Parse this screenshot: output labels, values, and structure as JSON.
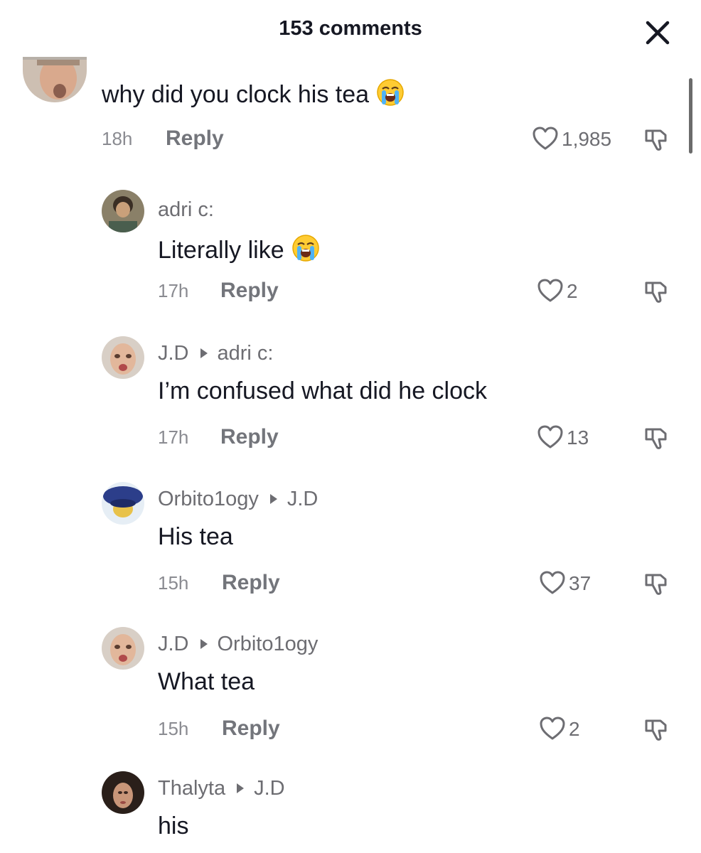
{
  "header": {
    "title": "153 comments",
    "close_icon": "close-icon"
  },
  "comments": [
    {
      "username": "",
      "reply_to": "",
      "text": "why did you clock his tea",
      "emoji": "😭",
      "time": "18h",
      "reply_label": "Reply",
      "likes": "1,985"
    },
    {
      "username": "adri c:",
      "reply_to": "",
      "text": "Literally like",
      "emoji": "😭",
      "time": "17h",
      "reply_label": "Reply",
      "likes": "2"
    },
    {
      "username": "J.D",
      "reply_to": "adri c:",
      "text": "I’m confused what did he clock",
      "emoji": "",
      "time": "17h",
      "reply_label": "Reply",
      "likes": "13"
    },
    {
      "username": "Orbito1ogy",
      "reply_to": "J.D",
      "text": "His tea",
      "emoji": "",
      "time": "15h",
      "reply_label": "Reply",
      "likes": "37"
    },
    {
      "username": "J.D",
      "reply_to": "Orbito1ogy",
      "text": "What tea",
      "emoji": "",
      "time": "15h",
      "reply_label": "Reply",
      "likes": "2"
    },
    {
      "username": "Thalyta",
      "reply_to": "J.D",
      "text": "his",
      "emoji": "",
      "time": "",
      "reply_label": "",
      "likes": ""
    }
  ],
  "icons": {
    "like": "heart-outline-icon",
    "dislike": "thumbs-down-icon",
    "reply_arrow": "reply-arrow-icon"
  },
  "colors": {
    "primary_text": "#161823",
    "secondary_text": "#6d6d72",
    "muted_text": "#8a8b91"
  }
}
